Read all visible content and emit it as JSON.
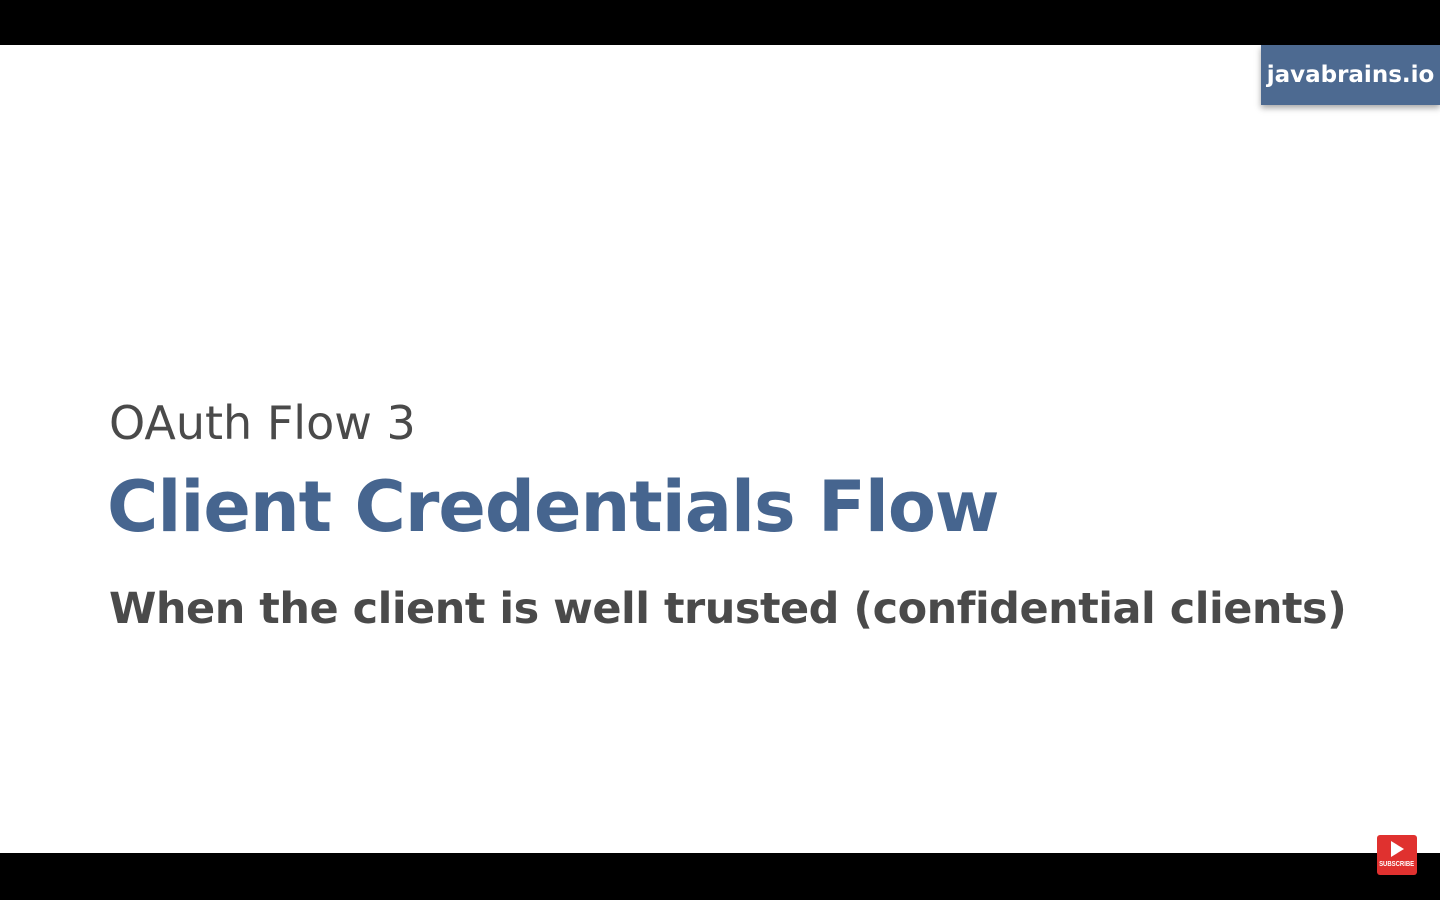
{
  "brand": {
    "label": "javabrains.io",
    "color": "#4d6a91"
  },
  "slide": {
    "kicker": "OAuth Flow 3",
    "title": "Client Credentials Flow",
    "subtitle": "When the client is well trusted (confidential clients)",
    "title_color": "#46658f",
    "text_color": "#4a4a4a"
  },
  "subscribe": {
    "label": "SUBSCRIBE",
    "icon": "play-icon",
    "color": "#e0312f"
  }
}
